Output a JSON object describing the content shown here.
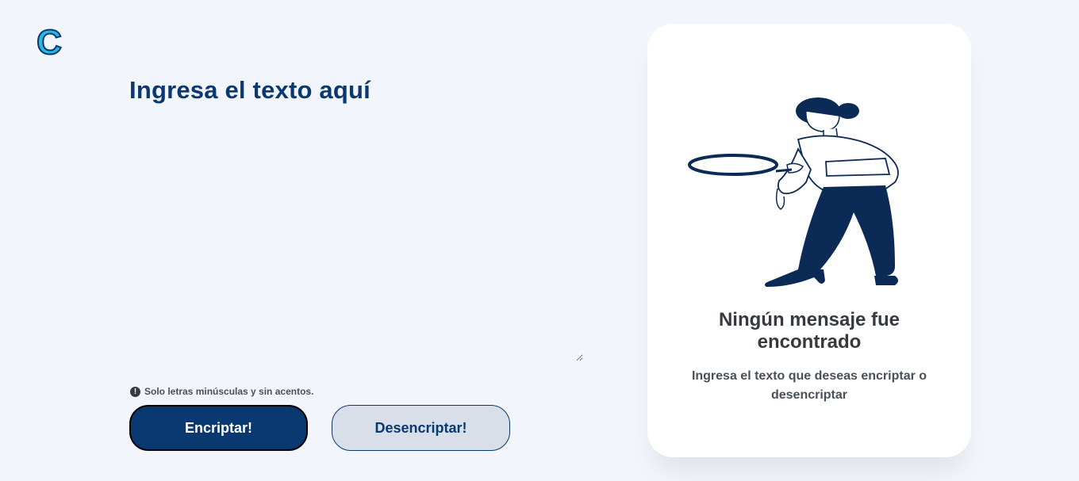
{
  "brand": {
    "logo_letter": "C",
    "accent_color": "#2ab7e0"
  },
  "input": {
    "title": "Ingresa el texto aquí",
    "value": "",
    "warning_text": "Solo letras minúsculas y sin acentos."
  },
  "actions": {
    "encrypt_label": "Encriptar!",
    "decrypt_label": "Desencriptar!"
  },
  "output": {
    "title": "Ningún mensaje fue encontrado",
    "subtitle": "Ingresa el texto que deseas encriptar o desencriptar",
    "illustration": "person-with-magnifying-glass"
  },
  "colors": {
    "primary": "#0a3871",
    "background": "#f2f5fc",
    "secondary_button": "#d8dfe8",
    "text_dark": "#343a40"
  }
}
